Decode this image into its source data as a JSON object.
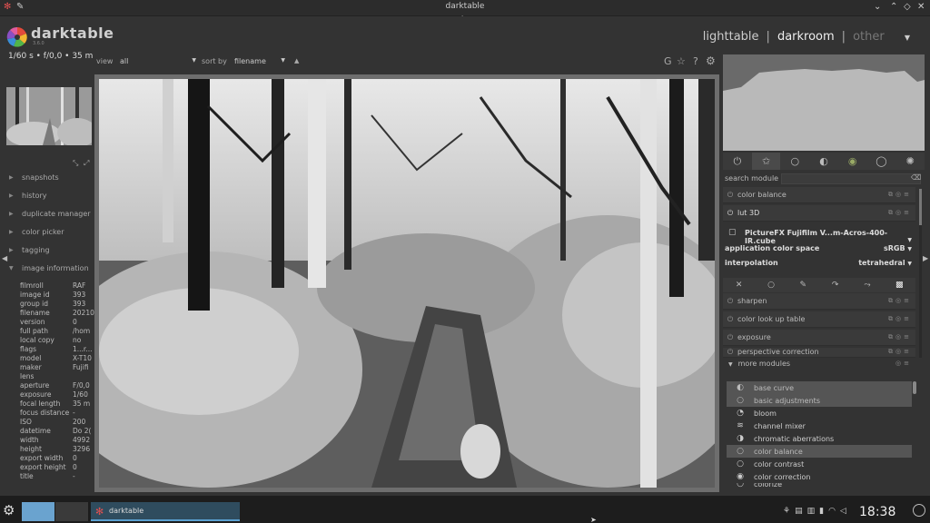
{
  "window": {
    "title": "darktable"
  },
  "header": {
    "app_name": "darktable",
    "version": "3.6.0",
    "views": [
      {
        "label": "lighttable",
        "state": "inactive"
      },
      {
        "label": "darkroom",
        "state": "active"
      },
      {
        "label": "other",
        "state": "dim"
      }
    ]
  },
  "left": {
    "exif_summary": "1/60 s • f/0,0 • 35 m",
    "modules": [
      {
        "label": "snapshots"
      },
      {
        "label": "history"
      },
      {
        "label": "duplicate manager"
      },
      {
        "label": "color picker"
      },
      {
        "label": "tagging"
      },
      {
        "label": "image information"
      }
    ],
    "info": [
      {
        "k": "filmroll",
        "v": "RAF"
      },
      {
        "k": "image id",
        "v": "393"
      },
      {
        "k": "group id",
        "v": "393"
      },
      {
        "k": "filename",
        "v": "20210"
      },
      {
        "k": "version",
        "v": "0"
      },
      {
        "k": "full path",
        "v": "/hom"
      },
      {
        "k": "local copy",
        "v": "no"
      },
      {
        "k": "flags",
        "v": "1...r..."
      },
      {
        "k": "model",
        "v": "X-T10"
      },
      {
        "k": "maker",
        "v": "Fujifi"
      },
      {
        "k": "lens",
        "v": ""
      },
      {
        "k": "aperture",
        "v": "F/0,0"
      },
      {
        "k": "exposure",
        "v": "1/60"
      },
      {
        "k": "focal length",
        "v": "35 m"
      },
      {
        "k": "focus distance",
        "v": "-"
      },
      {
        "k": "ISO",
        "v": "200"
      },
      {
        "k": "datetime",
        "v": "Do 2("
      },
      {
        "k": "width",
        "v": "4992"
      },
      {
        "k": "height",
        "v": "3296"
      },
      {
        "k": "export width",
        "v": "0"
      },
      {
        "k": "export height",
        "v": "0"
      },
      {
        "k": "title",
        "v": "-"
      }
    ]
  },
  "toolbar": {
    "view_label": "view",
    "view_value": "all",
    "sort_label": "sort by",
    "sort_value": "filename",
    "g_label": "G",
    "help_label": "?"
  },
  "right": {
    "search_label": "search module",
    "active_modules": [
      {
        "label": "color balance",
        "icon": "power"
      },
      {
        "label": "lut 3D",
        "icon": "power-on"
      }
    ],
    "lut": {
      "file": "PictureFX Fujifilm V...m-Acros-400-IR.cube",
      "rows": [
        {
          "k": "application color space",
          "v": "sRGB"
        },
        {
          "k": "interpolation",
          "v": "tetrahedral"
        }
      ]
    },
    "modules_after": [
      {
        "label": "sharpen"
      },
      {
        "label": "color look up table"
      },
      {
        "label": "exposure"
      },
      {
        "label": "perspective correction"
      }
    ],
    "more_modules_label": "more modules",
    "more_modules": [
      {
        "label": "base curve",
        "selected": true,
        "icon": "◐"
      },
      {
        "label": "basic adjustments",
        "selected": true,
        "icon": "○"
      },
      {
        "label": "bloom",
        "selected": false,
        "icon": "◔"
      },
      {
        "label": "channel mixer",
        "selected": false,
        "icon": "≋"
      },
      {
        "label": "chromatic aberrations",
        "selected": false,
        "icon": "◑"
      },
      {
        "label": "color balance",
        "selected": true,
        "icon": "○"
      },
      {
        "label": "color contrast",
        "selected": false,
        "icon": "○"
      },
      {
        "label": "color correction",
        "selected": false,
        "icon": "◉"
      },
      {
        "label": "colorize",
        "selected": false,
        "icon": "○"
      }
    ]
  },
  "taskbar": {
    "app_label": "darktable",
    "clock": "18:38"
  }
}
